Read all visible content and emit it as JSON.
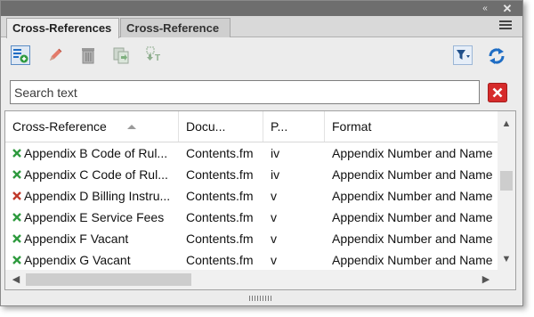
{
  "window": {
    "collapse_glyph": "«",
    "close_glyph": "✕"
  },
  "tabs": [
    {
      "label": "Cross-References",
      "active": true
    },
    {
      "label": "Cross-Reference",
      "active": false
    }
  ],
  "toolbar": {
    "buttons": [
      "new-cross-reference-icon",
      "edit-icon",
      "delete-icon",
      "copy-icon",
      "update-icon"
    ],
    "right_buttons": [
      "filter-icon",
      "refresh-icon"
    ]
  },
  "search": {
    "placeholder": "Search text",
    "value": ""
  },
  "table": {
    "columns": [
      {
        "label": "Cross-Reference",
        "sorted": "ascending"
      },
      {
        "label": "Docu..."
      },
      {
        "label": "P..."
      },
      {
        "label": "Format"
      }
    ],
    "rows": [
      {
        "status": "resolved",
        "name": "Appendix B Code of Rul...",
        "document": "Contents.fm",
        "page": "iv",
        "format": "Appendix Number and Name"
      },
      {
        "status": "resolved",
        "name": "Appendix C Code of Rul...",
        "document": "Contents.fm",
        "page": "iv",
        "format": "Appendix Number and Name"
      },
      {
        "status": "unresolved",
        "name": "Appendix D Billing Instru...",
        "document": "Contents.fm",
        "page": "v",
        "format": "Appendix Number and Name"
      },
      {
        "status": "resolved",
        "name": "Appendix E Service Fees",
        "document": "Contents.fm",
        "page": "v",
        "format": "Appendix Number and Name"
      },
      {
        "status": "resolved",
        "name": "Appendix F Vacant",
        "document": "Contents.fm",
        "page": "v",
        "format": "Appendix Number and Name"
      },
      {
        "status": "resolved",
        "name": "Appendix G Vacant",
        "document": "Contents.fm",
        "page": "v",
        "format": "Appendix Number and Name"
      }
    ]
  },
  "colors": {
    "resolved": "#2e9a3e",
    "unresolved": "#c0392b",
    "accent": "#1f6dc4",
    "clear_button": "#d62b2b"
  }
}
